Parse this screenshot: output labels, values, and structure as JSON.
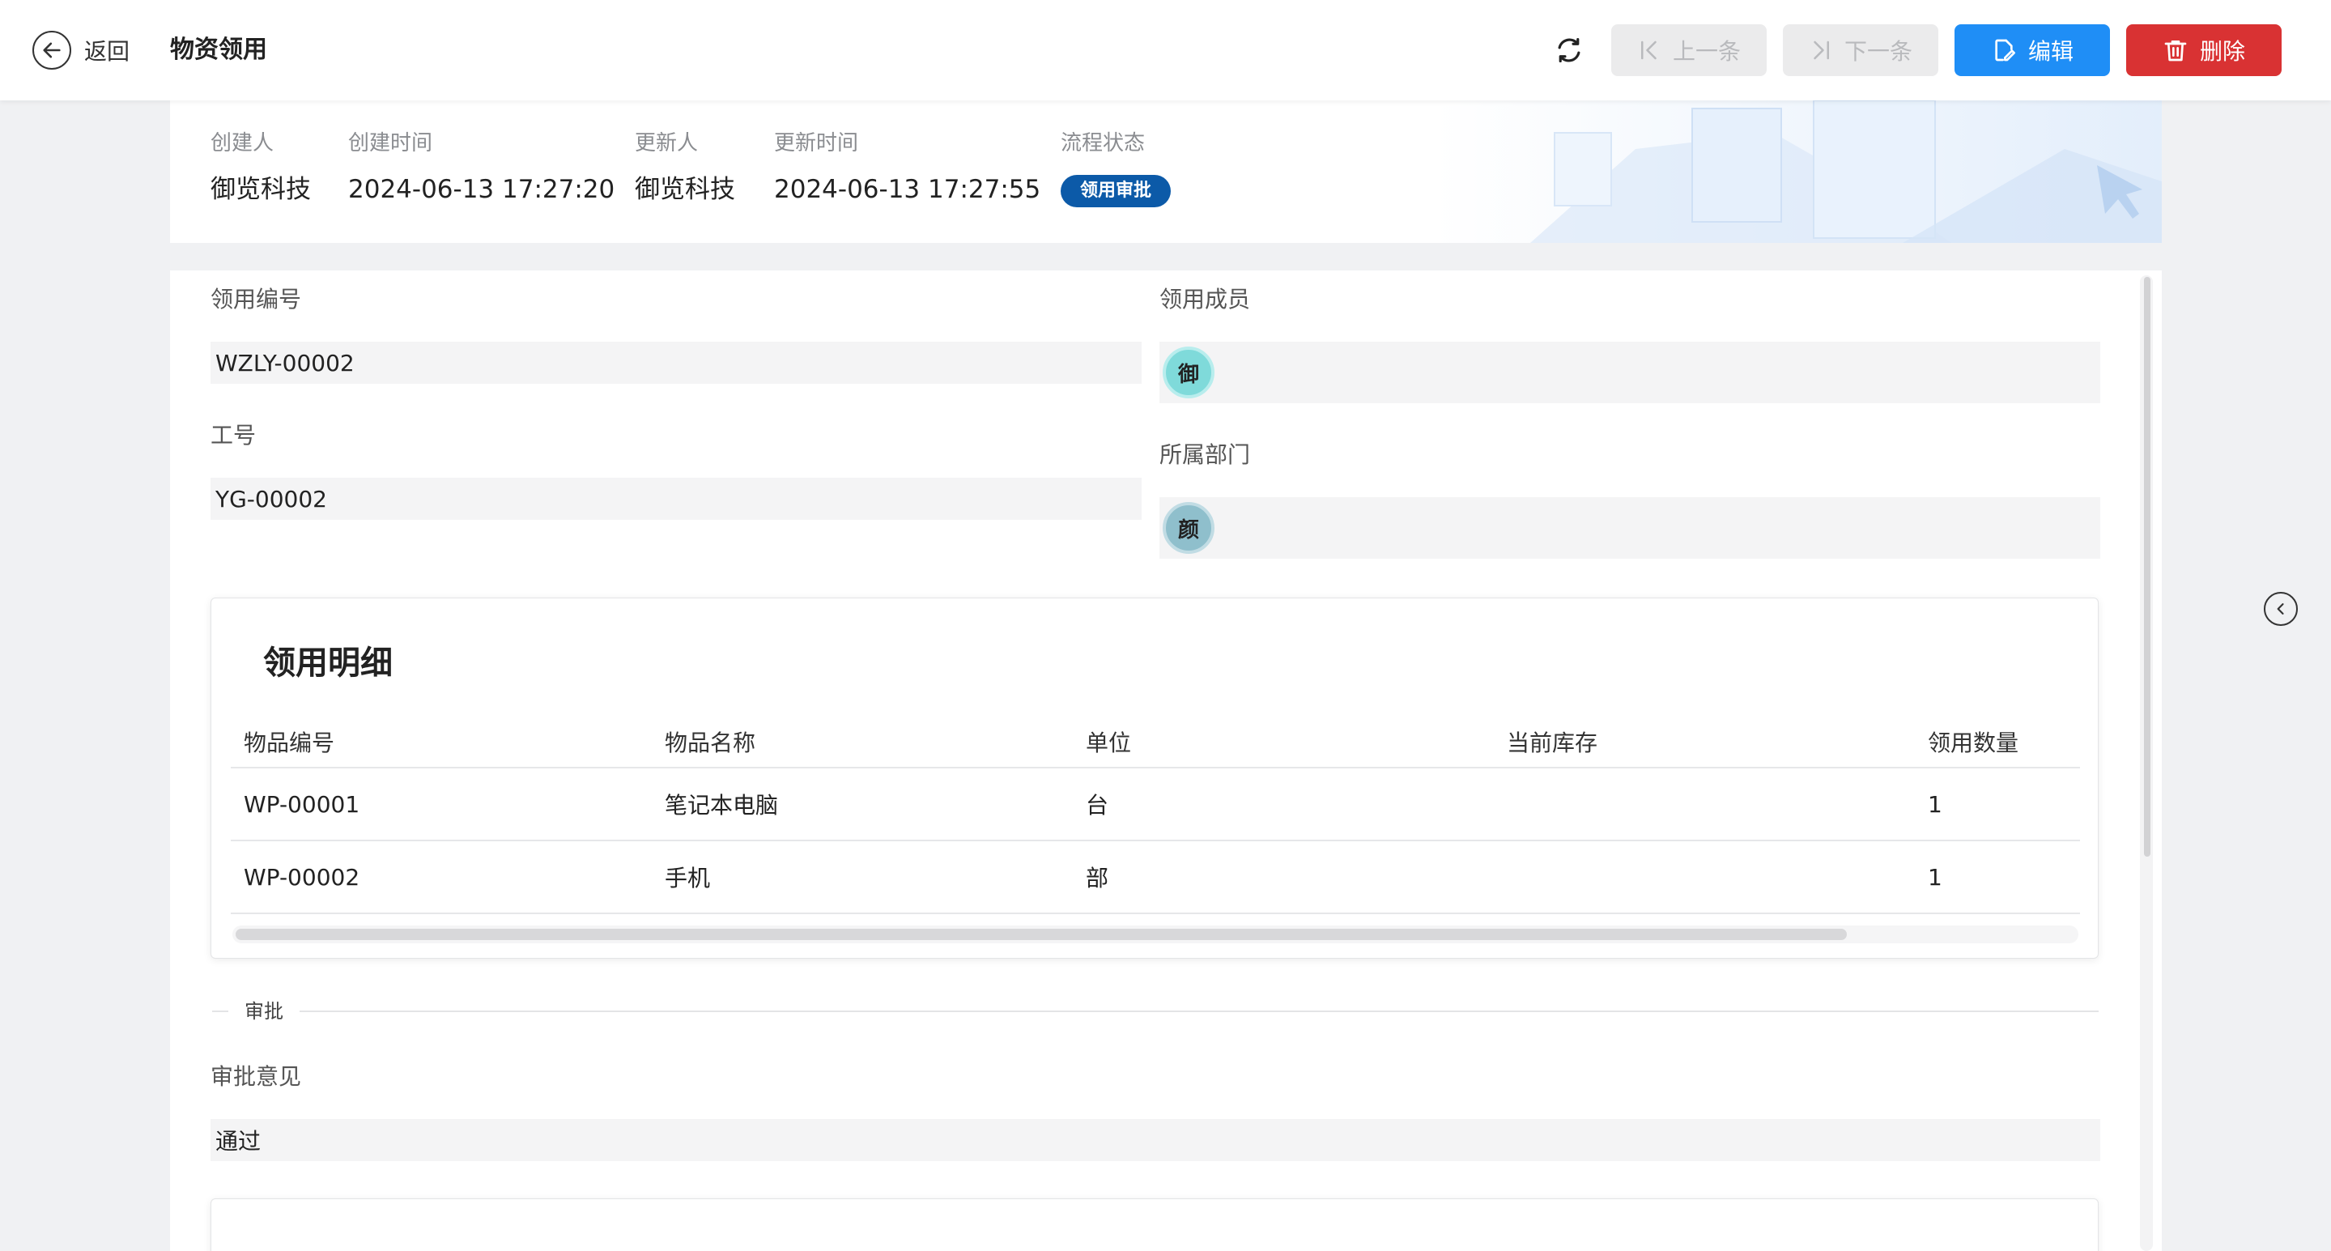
{
  "header": {
    "back_label": "返回",
    "title": "物资领用",
    "refresh_icon": "refresh-icon",
    "prev_label": "上一条",
    "next_label": "下一条",
    "edit_label": "编辑",
    "delete_label": "删除",
    "colors": {
      "edit": "#1f8ef6",
      "delete": "#d93233",
      "disabled": "#ebebec"
    }
  },
  "meta": {
    "creator_label": "创建人",
    "creator_value": "御览科技",
    "created_time_label": "创建时间",
    "created_time_value": "2024-06-13 17:27:20",
    "updater_label": "更新人",
    "updater_value": "御览科技",
    "updated_time_label": "更新时间",
    "updated_time_value": "2024-06-13 17:27:55",
    "status_label": "流程状态",
    "status_value": "领用审批",
    "status_color": "#0c5aa8"
  },
  "form": {
    "code_label": "领用编号",
    "code_value": "WZLY-00002",
    "member_label": "领用成员",
    "member_avatar": "御",
    "emp_no_label": "工号",
    "emp_no_value": "YG-00002",
    "dept_label": "所属部门",
    "dept_avatar": "颜"
  },
  "detail": {
    "title": "领用明细",
    "columns": [
      "物品编号",
      "物品名称",
      "单位",
      "当前库存",
      "领用数量"
    ],
    "rows": [
      {
        "code": "WP-00001",
        "name": "笔记本电脑",
        "unit": "台",
        "stock": "",
        "qty": "1"
      },
      {
        "code": "WP-00002",
        "name": "手机",
        "unit": "部",
        "stock": "",
        "qty": "1"
      }
    ]
  },
  "approval": {
    "section_label": "审批",
    "opinion_label": "审批意见",
    "opinion_value": "通过"
  }
}
